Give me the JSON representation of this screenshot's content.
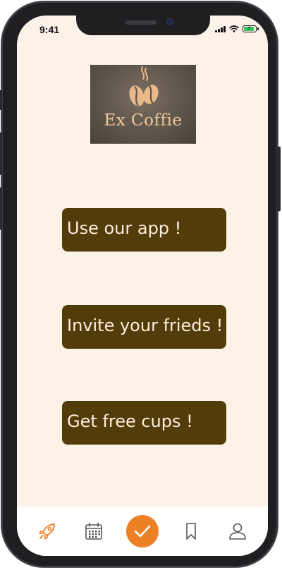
{
  "status_bar": {
    "time": "9:41"
  },
  "logo": {
    "text": "Ex Coffie",
    "icon": "coffee-bean-icon"
  },
  "actions": [
    {
      "label": "Use our app !"
    },
    {
      "label": "Invite your frieds !"
    },
    {
      "label": "Get free cups !"
    }
  ],
  "tabbar": {
    "items": [
      {
        "icon": "rocket-icon"
      },
      {
        "icon": "calendar-icon"
      },
      {
        "icon": "checkmark-icon",
        "active": true
      },
      {
        "icon": "bookmark-icon"
      },
      {
        "icon": "profile-icon"
      }
    ]
  },
  "colors": {
    "background": "#fcf2e8",
    "button": "#523c0a",
    "button_text": "#fdeedd",
    "accent": "#ec8024",
    "logo_text": "#f0c89a"
  }
}
